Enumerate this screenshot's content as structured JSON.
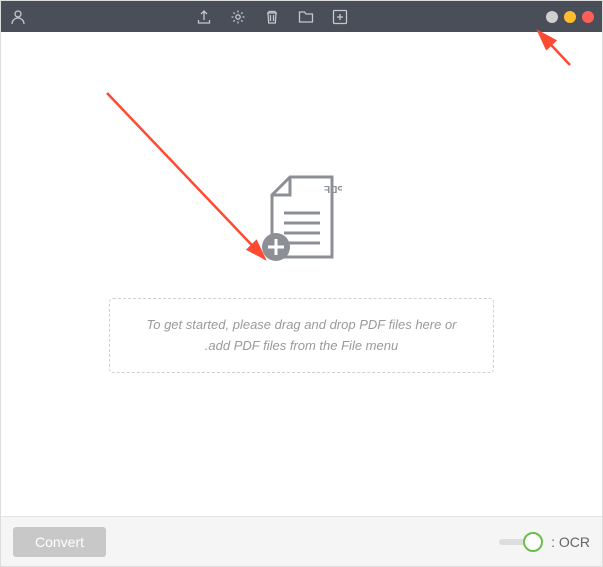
{
  "titlebar": {
    "traffic_colors": [
      "#ff5f57",
      "#febc2e",
      "#cfcfcf"
    ]
  },
  "toolbar": {
    "icons": [
      "add-file-icon",
      "folder-icon",
      "trash-icon",
      "gear-icon",
      "export-icon"
    ]
  },
  "main": {
    "pdf_label": "PDF",
    "drop_hint_line1": "To get started, please drag and drop PDF files here or",
    "drop_hint_line2": "add PDF files from the File menu."
  },
  "bottom": {
    "ocr_label": "OCR :",
    "ocr_on": false,
    "convert_label": "Convert"
  },
  "annotation": {
    "arrows": 2
  }
}
